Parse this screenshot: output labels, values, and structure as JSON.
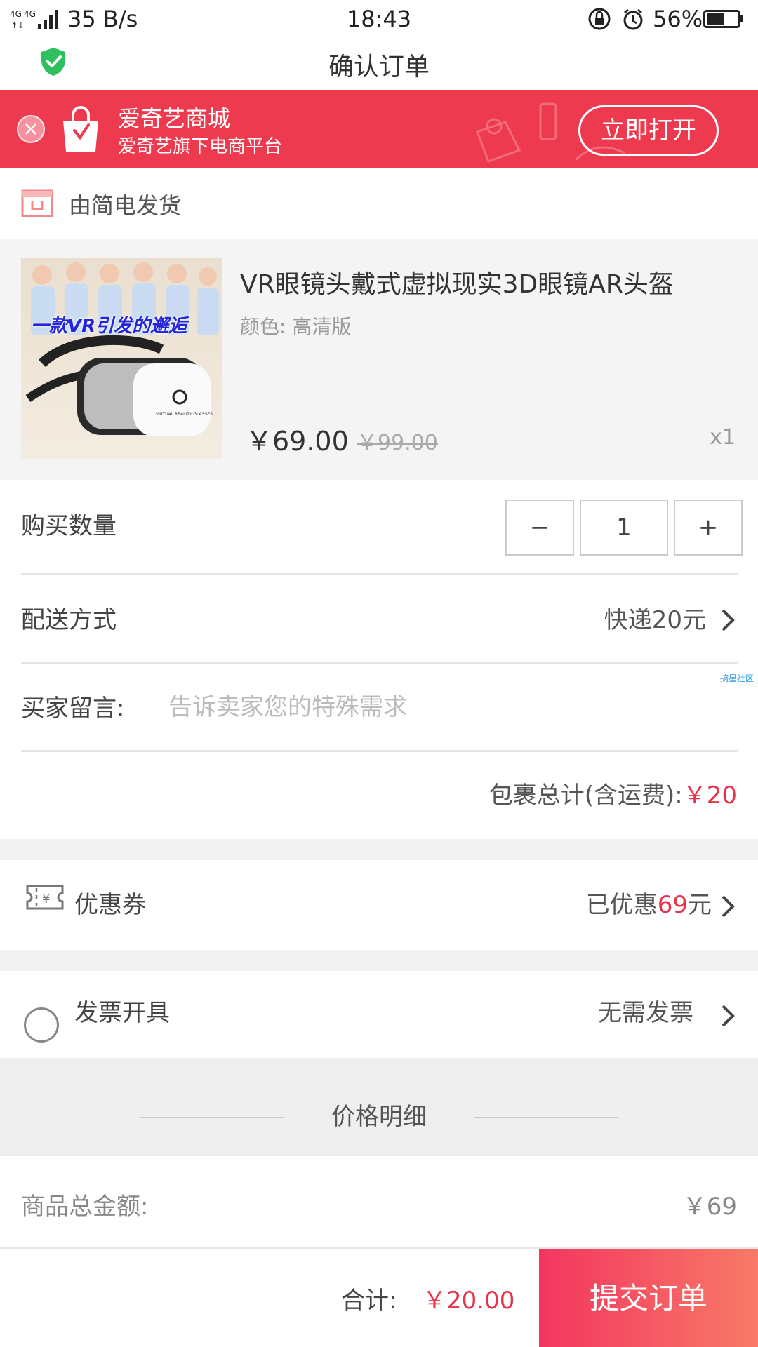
{
  "status_bar": {
    "network": "4G 4G",
    "speed": "35 B/s",
    "time": "18:43",
    "battery": "56%",
    "battery_level": 0.56
  },
  "header": {
    "title": "确认订单"
  },
  "banner": {
    "title": "爱奇艺商城",
    "subtitle": "爱奇艺旗下电商平台",
    "open_button": "立即打开",
    "color": "#ee3a4f"
  },
  "shipper": {
    "text": "由简电发货"
  },
  "product": {
    "image_caption": "一款VR引发的邂逅",
    "image_logo_text": "VIRTUAL REALITY GLASSES",
    "name": "VR眼镜头戴式虚拟现实3D眼镜AR头盔",
    "variant": "颜色: 高清版",
    "price": "￥69.00",
    "original_price": "￥99.00",
    "quantity": "x1"
  },
  "quantity_row": {
    "label": "购买数量",
    "minus": "−",
    "value": "1",
    "plus": "+"
  },
  "shipping_row": {
    "label": "配送方式",
    "value": "快递20元"
  },
  "message_row": {
    "label": "买家留言:",
    "placeholder": "告诉卖家您的特殊需求",
    "watermark": "搞星社区"
  },
  "subtotal_row": {
    "label": "包裹总计(含运费):",
    "value": "￥20"
  },
  "coupon_row": {
    "label": "优惠券",
    "prefix": "已优惠",
    "amount": "69",
    "suffix": "元"
  },
  "invoice_row": {
    "label": "发票开具",
    "value": "无需发票"
  },
  "price_detail": {
    "title": "价格明细",
    "goods_total_label": "商品总金额:",
    "goods_total_value": "￥69"
  },
  "bottom_bar": {
    "total_label": "合计:",
    "total_value": "￥20.00",
    "submit": "提交订单"
  },
  "colors": {
    "accent_red": "#e8344a",
    "submit_gradient_start": "#f3365f",
    "submit_gradient_end": "#f87a67"
  }
}
